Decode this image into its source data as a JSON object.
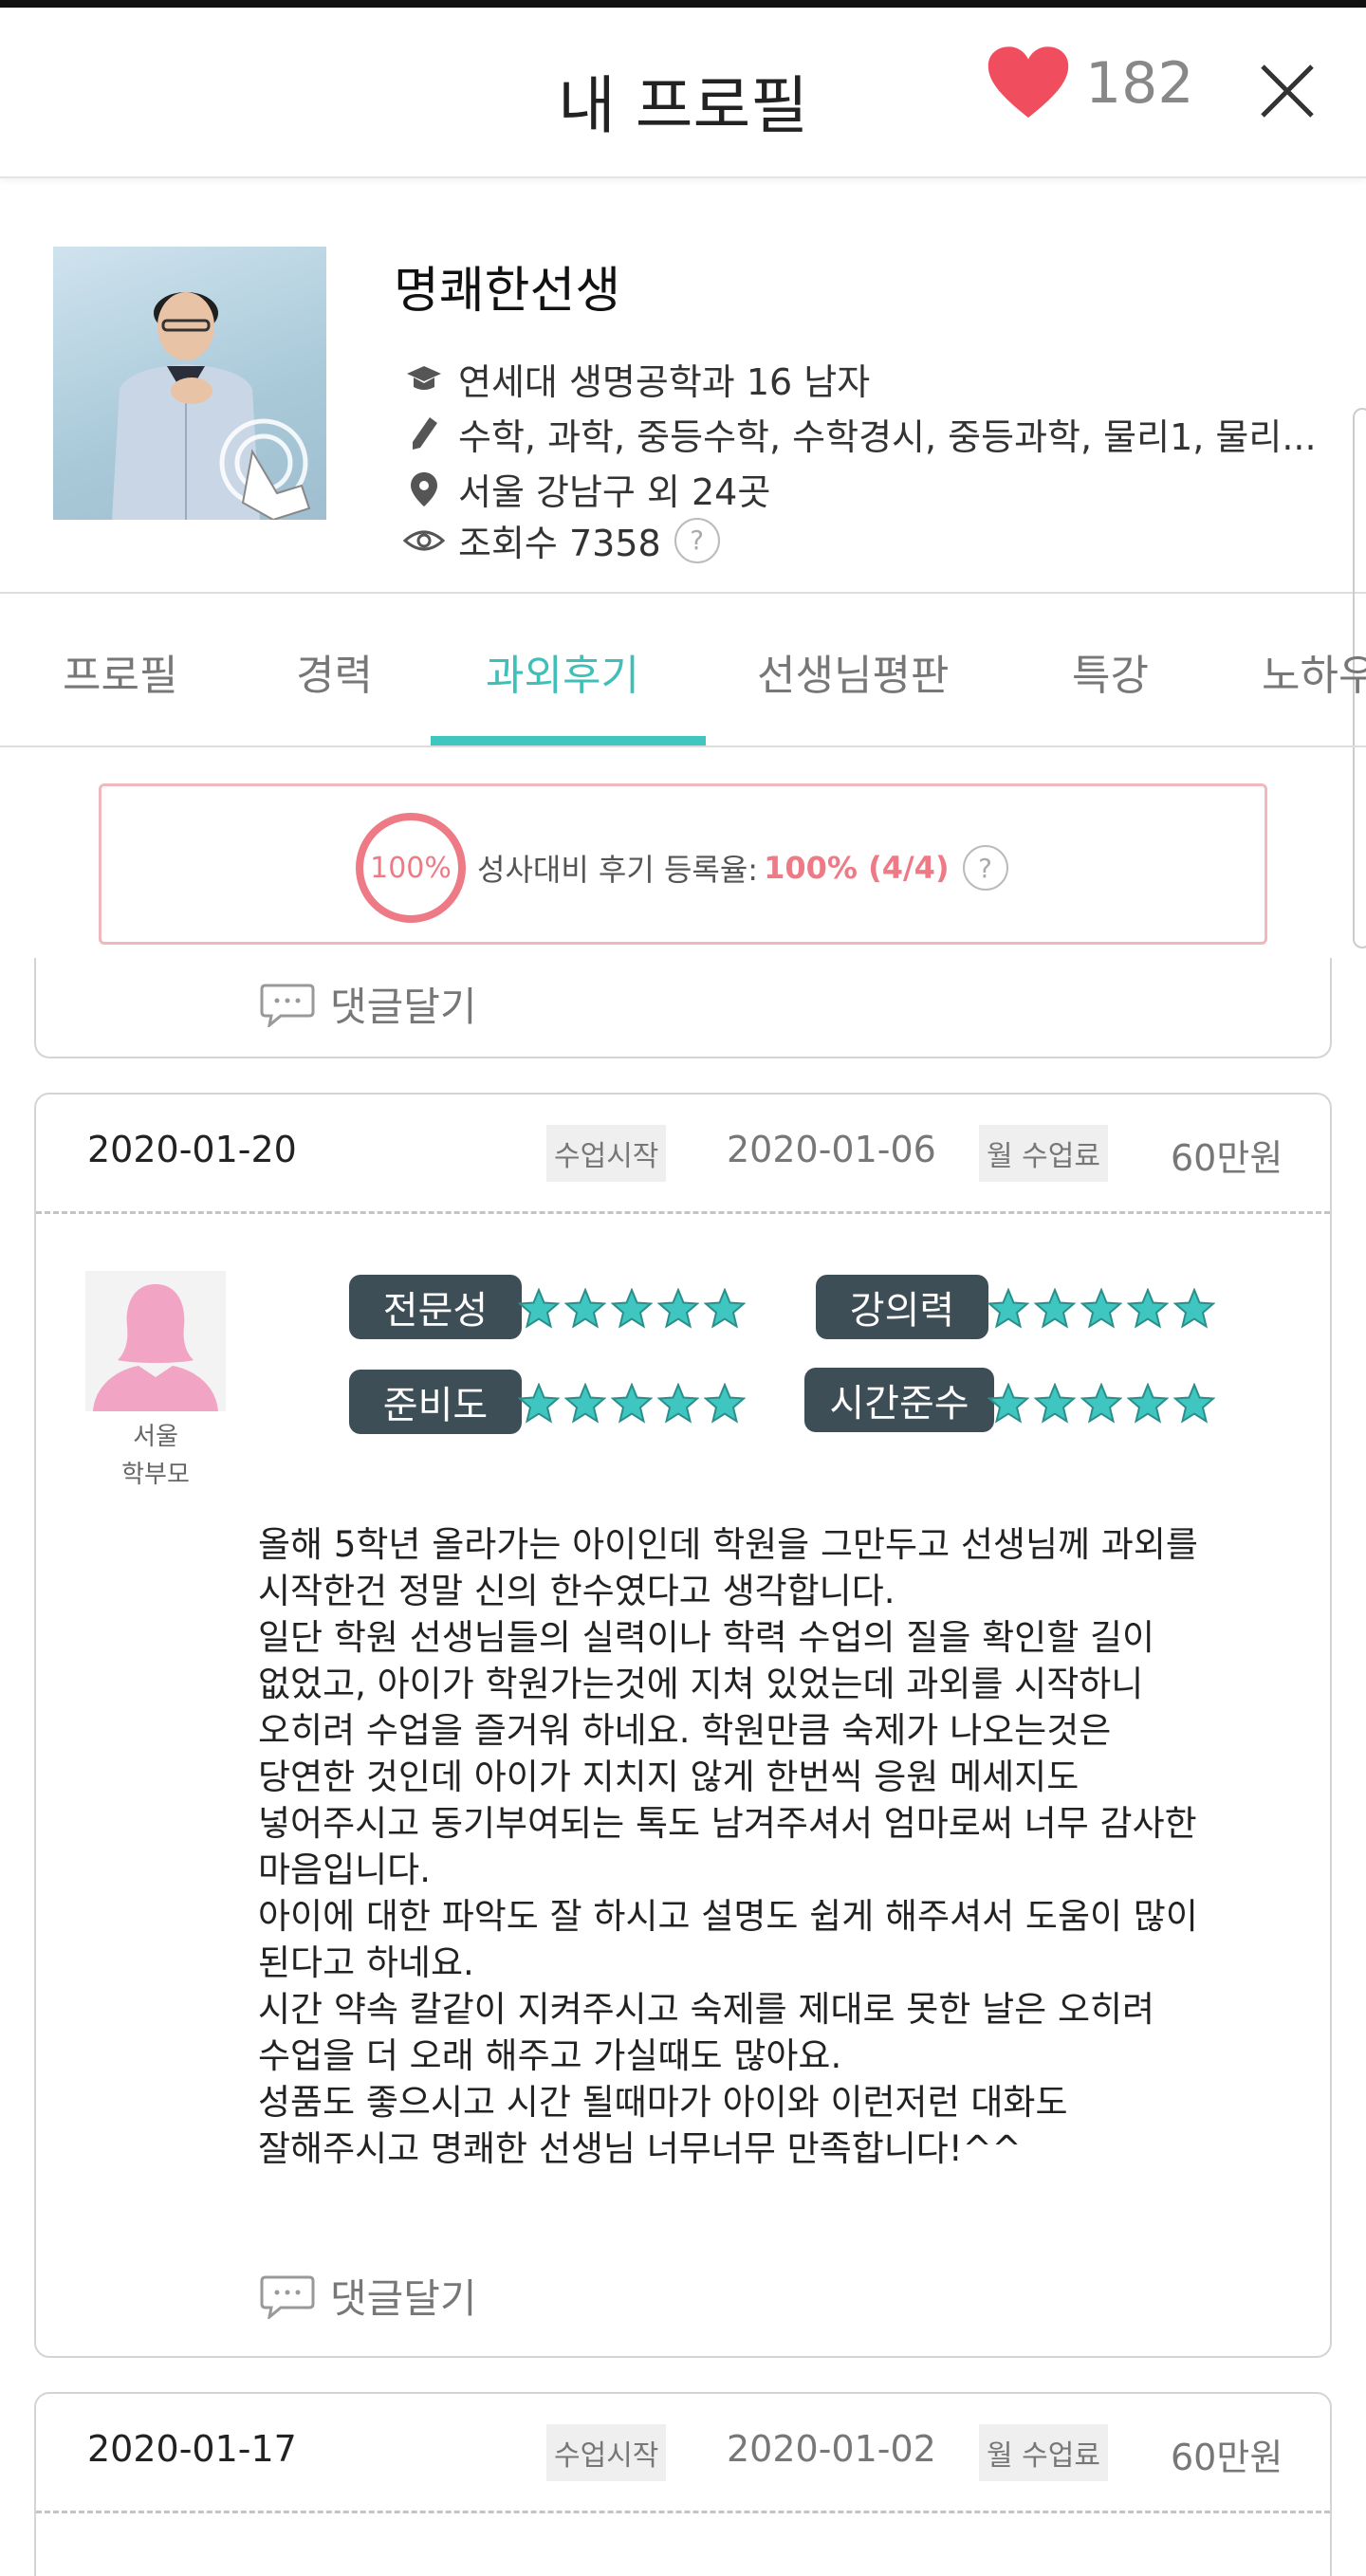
{
  "header": {
    "title": "내 프로필",
    "like_count": "182"
  },
  "profile": {
    "name": "명쾌한선생",
    "school": "연세대 생명공학과 16 남자",
    "subjects": "수학, 과학, 중등수학, 수학경시, 중등과학, 물리1, 물리...",
    "location": "서울 강남구 외 24곳",
    "views": "조회수 7358",
    "help": "?"
  },
  "tabs": [
    {
      "label": "프로필"
    },
    {
      "label": "경력"
    },
    {
      "label": "과외후기",
      "active": true
    },
    {
      "label": "선생님평판"
    },
    {
      "label": "특강"
    },
    {
      "label": "노하우"
    }
  ],
  "stats": {
    "ring_text": "100%",
    "label": "성사대비 후기 등록율:",
    "value": "100% (4/4)",
    "help": "?"
  },
  "reply_label": "댓글달기",
  "reviews": [
    {
      "date": "2020-01-20",
      "start_tag": "수업시작",
      "start_date": "2020-01-06",
      "fee_tag": "월 수업료",
      "fee": "60만원",
      "reviewer_region": "서울",
      "reviewer_type": "학부모",
      "ratings": [
        {
          "label": "전문성",
          "stars": 5
        },
        {
          "label": "강의력",
          "stars": 5
        },
        {
          "label": "준비도",
          "stars": 5
        },
        {
          "label": "시간준수",
          "stars": 5
        }
      ],
      "text": "올해 5학년 올라가는 아이인데 학원을 그만두고 선생님께 과외를\n시작한건 정말 신의 한수였다고 생각합니다.\n일단 학원 선생님들의 실력이나 학력 수업의 질을 확인할 길이\n없었고, 아이가 학원가는것에 지쳐 있었는데 과외를 시작하니\n오히려 수업을 즐거워 하네요. 학원만큼 숙제가 나오는것은\n당연한 것인데 아이가 지치지 않게 한번씩 응원 메세지도\n넣어주시고 동기부여되는 톡도 남겨주셔서 엄마로써 너무 감사한\n마음입니다.\n아이에 대한 파악도 잘 하시고 설명도 쉽게 해주셔서  도움이 많이\n된다고 하네요.\n시간 약속 칼같이 지켜주시고 숙제를 제대로 못한 날은 오히려\n수업을 더 오래 해주고 가실때도 많아요.\n성품도 좋으시고 시간 될때마가 아이와 이런저런 대화도\n잘해주시고 명쾌한 선생님 너무너무 만족합니다!^^"
    },
    {
      "date": "2020-01-17",
      "start_tag": "수업시작",
      "start_date": "2020-01-02",
      "fee_tag": "월 수업료",
      "fee": "60만원"
    }
  ],
  "colors": {
    "accent": "#3fbfb8",
    "heart": "#f04e5e",
    "pink": "#ee7a86",
    "label_bg": "#3e4e57",
    "star": "#3fc6c0"
  }
}
